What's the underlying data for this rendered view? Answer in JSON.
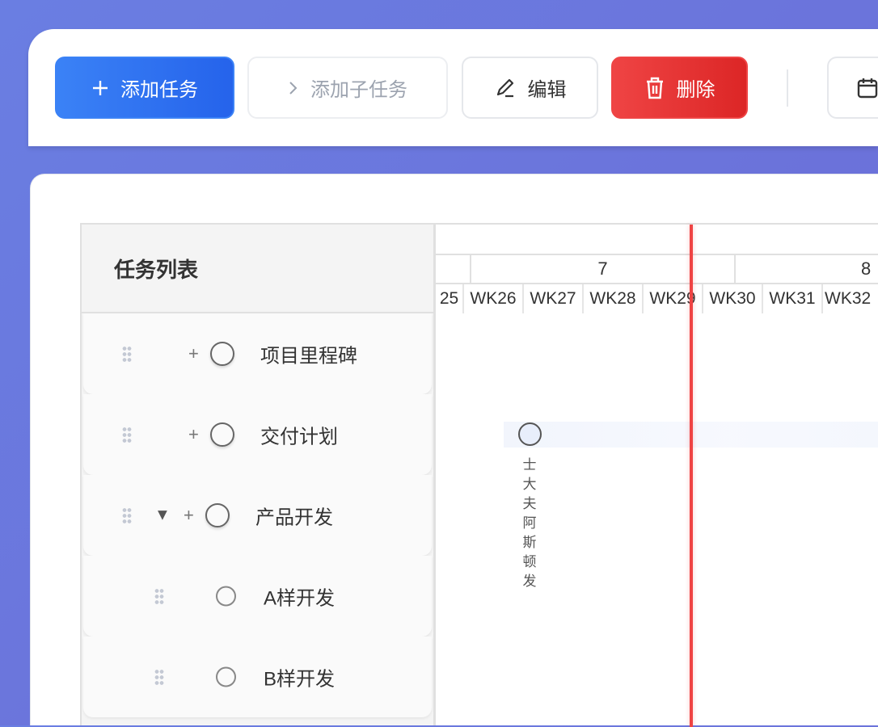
{
  "toolbar": {
    "add_task": "添加任务",
    "add_subtask": "添加子任务",
    "edit": "编辑",
    "delete": "删除"
  },
  "task_list": {
    "title": "任务列表",
    "rows": [
      {
        "name": "项目里程碑",
        "expandable": false
      },
      {
        "name": "交付计划",
        "expandable": false
      },
      {
        "name": "产品开发",
        "expandable": true,
        "expanded": true
      },
      {
        "name": "A样开发",
        "child": true
      },
      {
        "name": "B样开发",
        "child": true
      }
    ]
  },
  "timeline": {
    "months": [
      "7",
      "8"
    ],
    "weeks": [
      "25",
      "WK26",
      "WK27",
      "WK28",
      "WK29",
      "WK30",
      "WK31",
      "WK32"
    ],
    "milestone_label": "士大夫阿斯顿发"
  },
  "colors": {
    "primary": "#2563eb",
    "danger": "#ef4444",
    "today_line": "#ef4444"
  }
}
